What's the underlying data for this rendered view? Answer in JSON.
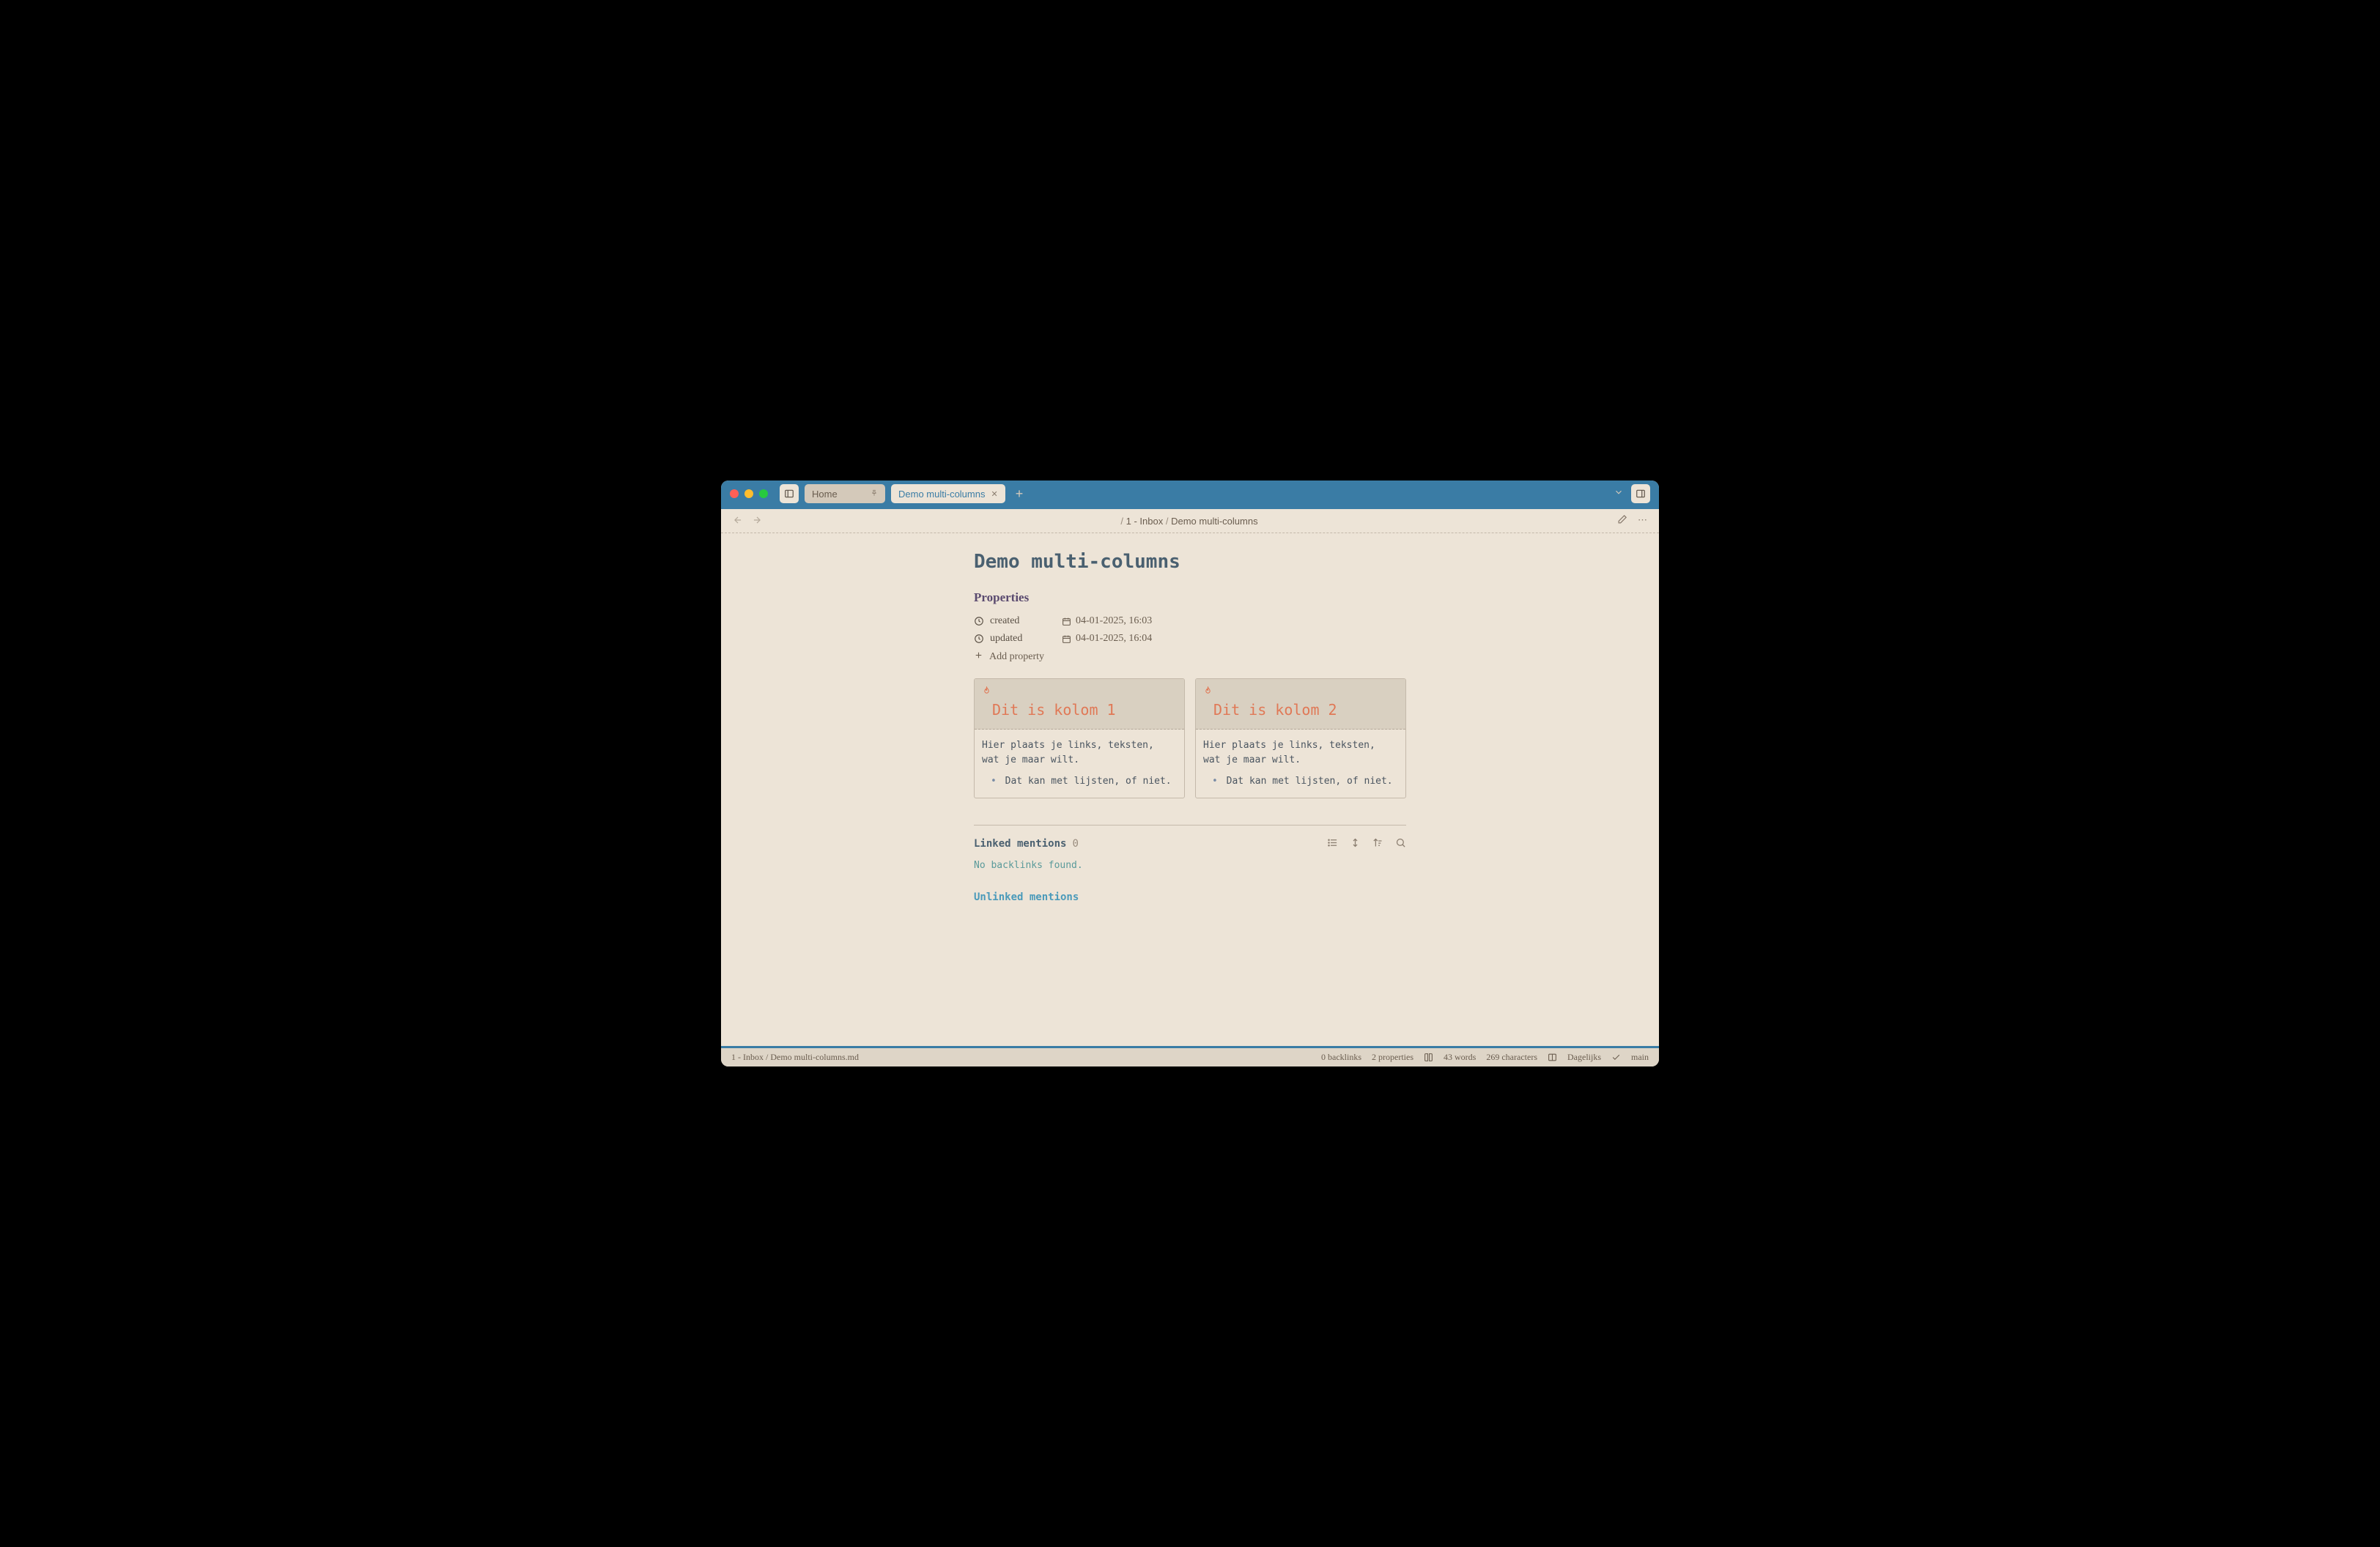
{
  "titlebar": {
    "tabs": [
      {
        "label": "Home",
        "pinned": true,
        "active": false
      },
      {
        "label": "Demo multi-columns",
        "pinned": false,
        "active": true
      }
    ]
  },
  "breadcrumb": {
    "sep1": "/",
    "part1": "1 - Inbox",
    "sep2": "/",
    "part2": "Demo multi-columns"
  },
  "page": {
    "title": "Demo multi-columns",
    "properties_heading": "Properties",
    "properties": [
      {
        "key": "created",
        "value": "04-01-2025, 16:03"
      },
      {
        "key": "updated",
        "value": "04-01-2025, 16:04"
      }
    ],
    "add_property_label": "Add property"
  },
  "columns": [
    {
      "title": "Dit is kolom 1",
      "body": "Hier plaats je links, teksten, wat je maar wilt.",
      "bullet": "Dat kan met lijsten, of niet."
    },
    {
      "title": "Dit is kolom 2",
      "body": "Hier plaats je links, teksten, wat je maar wilt.",
      "bullet": "Dat kan met lijsten, of niet."
    }
  ],
  "linked": {
    "label": "Linked mentions",
    "count": "0",
    "empty": "No backlinks found."
  },
  "unlinked": {
    "label": "Unlinked mentions"
  },
  "statusbar": {
    "path": "1 - Inbox / Demo multi-columns.md",
    "backlinks": "0 backlinks",
    "properties": "2 properties",
    "words": "43 words",
    "chars": "269 characters",
    "workspace": "Dagelijks",
    "branch": "main"
  }
}
